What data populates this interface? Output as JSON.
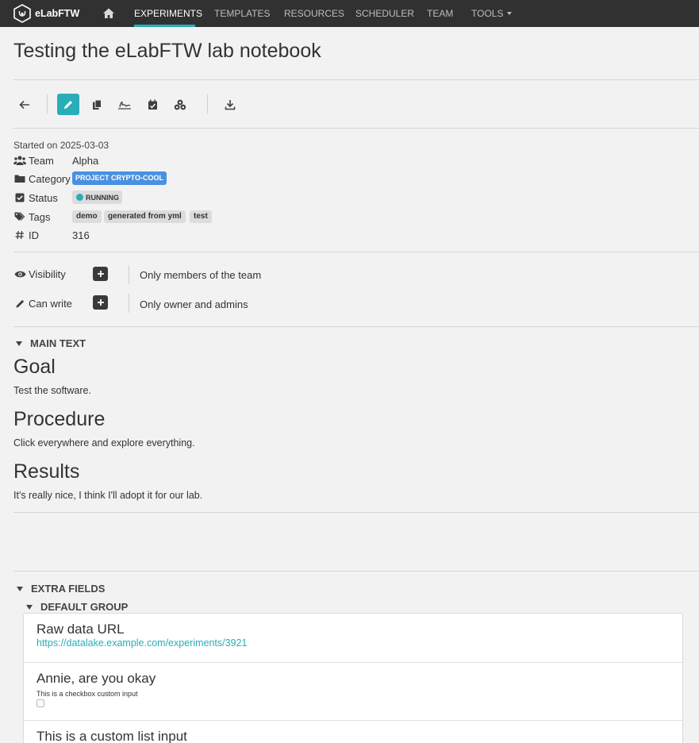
{
  "navbar": {
    "brand": "eLabFTW",
    "links": [
      "EXPERIMENTS",
      "TEMPLATES",
      "RESOURCES",
      "SCHEDULER",
      "TEAM",
      "TOOLS"
    ],
    "active": "EXPERIMENTS",
    "accent_color": "#29aeb9"
  },
  "page": {
    "title": "Testing the eLabFTW lab notebook"
  },
  "toolbar": {
    "icons": [
      "arrow-left-icon",
      "pencil-icon",
      "duplicate-icon",
      "sign-icon",
      "calendar-check-icon",
      "cubes-icon",
      "download-icon"
    ]
  },
  "meta": {
    "started": "Started on 2025-03-03",
    "team_label": "Team",
    "team_value": "Alpha",
    "category_label": "Category",
    "category_value": "PROJECT CRYPTO-COOL",
    "category_color": "#4a90e2",
    "status_label": "Status",
    "status_value": "RUNNING",
    "status_color": "#29aeb9",
    "tags_label": "Tags",
    "tags": [
      "demo",
      "generated from yml",
      "test"
    ],
    "id_label": "ID",
    "id_value": "316"
  },
  "permissions": {
    "visibility_label": "Visibility",
    "visibility_value": "Only members of the team",
    "canwrite_label": "Can write",
    "canwrite_value": "Only owner and admins"
  },
  "main_text": {
    "header": "MAIN TEXT",
    "goal_heading": "Goal",
    "goal_text": "Test the software.",
    "procedure_heading": "Procedure",
    "procedure_text": "Click everywhere and explore everything.",
    "results_heading": "Results",
    "results_text": "It's really nice, I think I'll adopt it for our lab."
  },
  "extra_fields": {
    "header": "EXTRA FIELDS",
    "group": "DEFAULT GROUP",
    "fields": [
      {
        "title": "Raw data URL",
        "value": "https://datalake.example.com/experiments/3921"
      },
      {
        "title": "Annie, are you okay",
        "description": "This is a checkbox custom input",
        "checked": false
      },
      {
        "title": "This is a custom list input"
      }
    ]
  }
}
